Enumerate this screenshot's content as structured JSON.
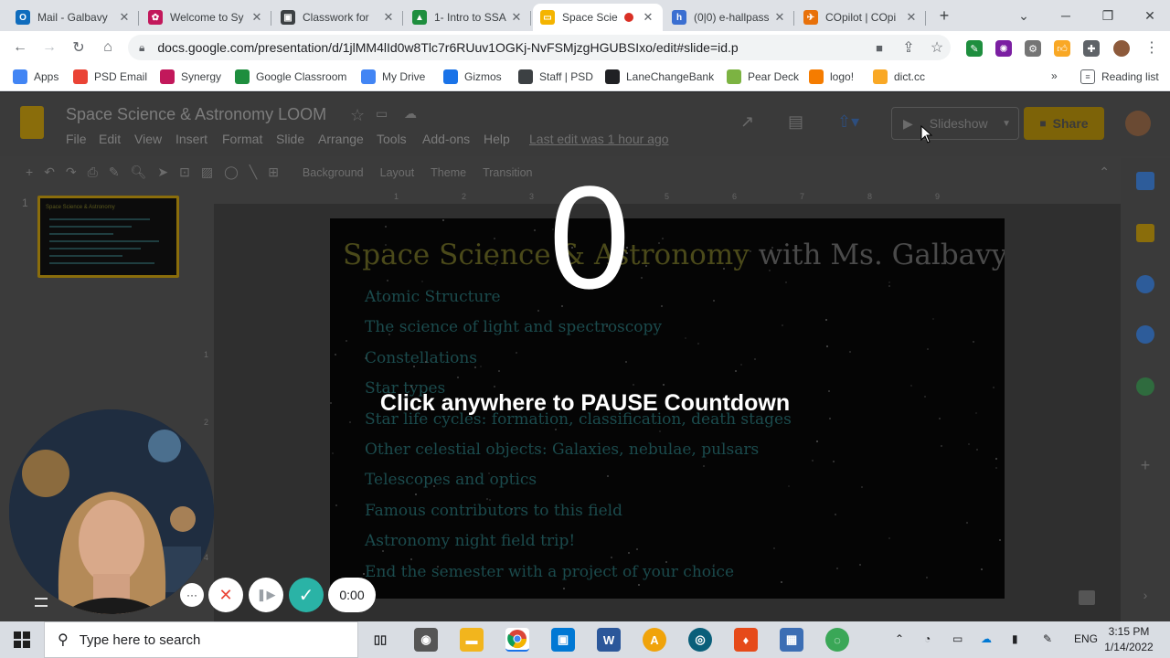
{
  "browser": {
    "tabs": [
      {
        "title": "Mail - Galbavy",
        "color": "#0f6cbd",
        "glyph": "O"
      },
      {
        "title": "Welcome to Sy",
        "color": "#c2185b",
        "glyph": "✿"
      },
      {
        "title": "Classwork for",
        "color": "#3c4043",
        "glyph": "▣"
      },
      {
        "title": "1- Intro to SSA",
        "color": "#1e8e3e",
        "glyph": "▲"
      },
      {
        "title": "Space Scie",
        "color": "#f4b400",
        "glyph": "▭",
        "active": true
      },
      {
        "title": "(0|0) e-hallpass",
        "color": "#3b6fd1",
        "glyph": "h"
      },
      {
        "title": "COpilot | COpi",
        "color": "#e8710a",
        "glyph": "✈"
      }
    ],
    "tab_close": "✕",
    "new_tab": "+",
    "url": "docs.google.com/presentation/d/1jlMM4lId0w8Tlc7r6RUuv1OGKj-NvFSMjzgHGUBSIxo/edit#slide=id.p",
    "bookmarks": [
      {
        "label": "Apps",
        "color": "#4285f4"
      },
      {
        "label": "PSD Email",
        "color": "#ea4335"
      },
      {
        "label": "Synergy",
        "color": "#c2185b"
      },
      {
        "label": "Google Classroom",
        "color": "#1e8e3e"
      },
      {
        "label": "My Drive",
        "color": "#4285f4"
      },
      {
        "label": "Gizmos",
        "color": "#1a73e8"
      },
      {
        "label": "Staff | PSD",
        "color": "#3c4043"
      },
      {
        "label": "LaneChangeBank",
        "color": "#202124"
      },
      {
        "label": "Pear Deck",
        "color": "#7cb342"
      },
      {
        "label": "logo!",
        "color": "#f57c00"
      },
      {
        "label": "dict.cc",
        "color": "#f9a825"
      }
    ],
    "bookmarks_more": "»",
    "reading_list": "Reading list"
  },
  "doc": {
    "title": "Space Science & Astronomy LOOM",
    "menus": [
      "File",
      "Edit",
      "View",
      "Insert",
      "Format",
      "Slide",
      "Arrange",
      "Tools",
      "Add-ons",
      "Help"
    ],
    "last_edit": "Last edit was 1 hour ago",
    "slideshow_label": "Slideshow",
    "share_label": "Share",
    "toolbar_text": [
      "Background",
      "Layout",
      "Theme",
      "Transition"
    ],
    "slide_number": "1",
    "ruler_h": [
      "1",
      "2",
      "3",
      "4",
      "5",
      "6",
      "7",
      "8",
      "9"
    ],
    "ruler_v": [
      "1",
      "2",
      "3",
      "4",
      "5"
    ]
  },
  "slide": {
    "title_part1": "Space Science & Astronomy",
    "title_part2": " with Ms. Galbavy",
    "items": [
      "Atomic Structure",
      "The science of light and spectroscopy",
      "Constellations",
      "Star types",
      "Star life cycles: formation, classification, death stages",
      "Other celestial objects: Galaxies, nebulae, pulsars",
      "Telescopes and optics",
      "Famous contributors to this field",
      "Astronomy night field trip!",
      "End the semester with a project of your choice"
    ]
  },
  "loom": {
    "countdown": "0",
    "pause_message": "Click anywhere to PAUSE Countdown",
    "timer": "0:00",
    "more": "···",
    "cancel": "✕",
    "pause": "❚▶",
    "done": "✓"
  },
  "taskbar": {
    "search_placeholder": "Type here to search",
    "language": "ENG",
    "time": "3:15 PM",
    "date": "1/14/2022"
  }
}
